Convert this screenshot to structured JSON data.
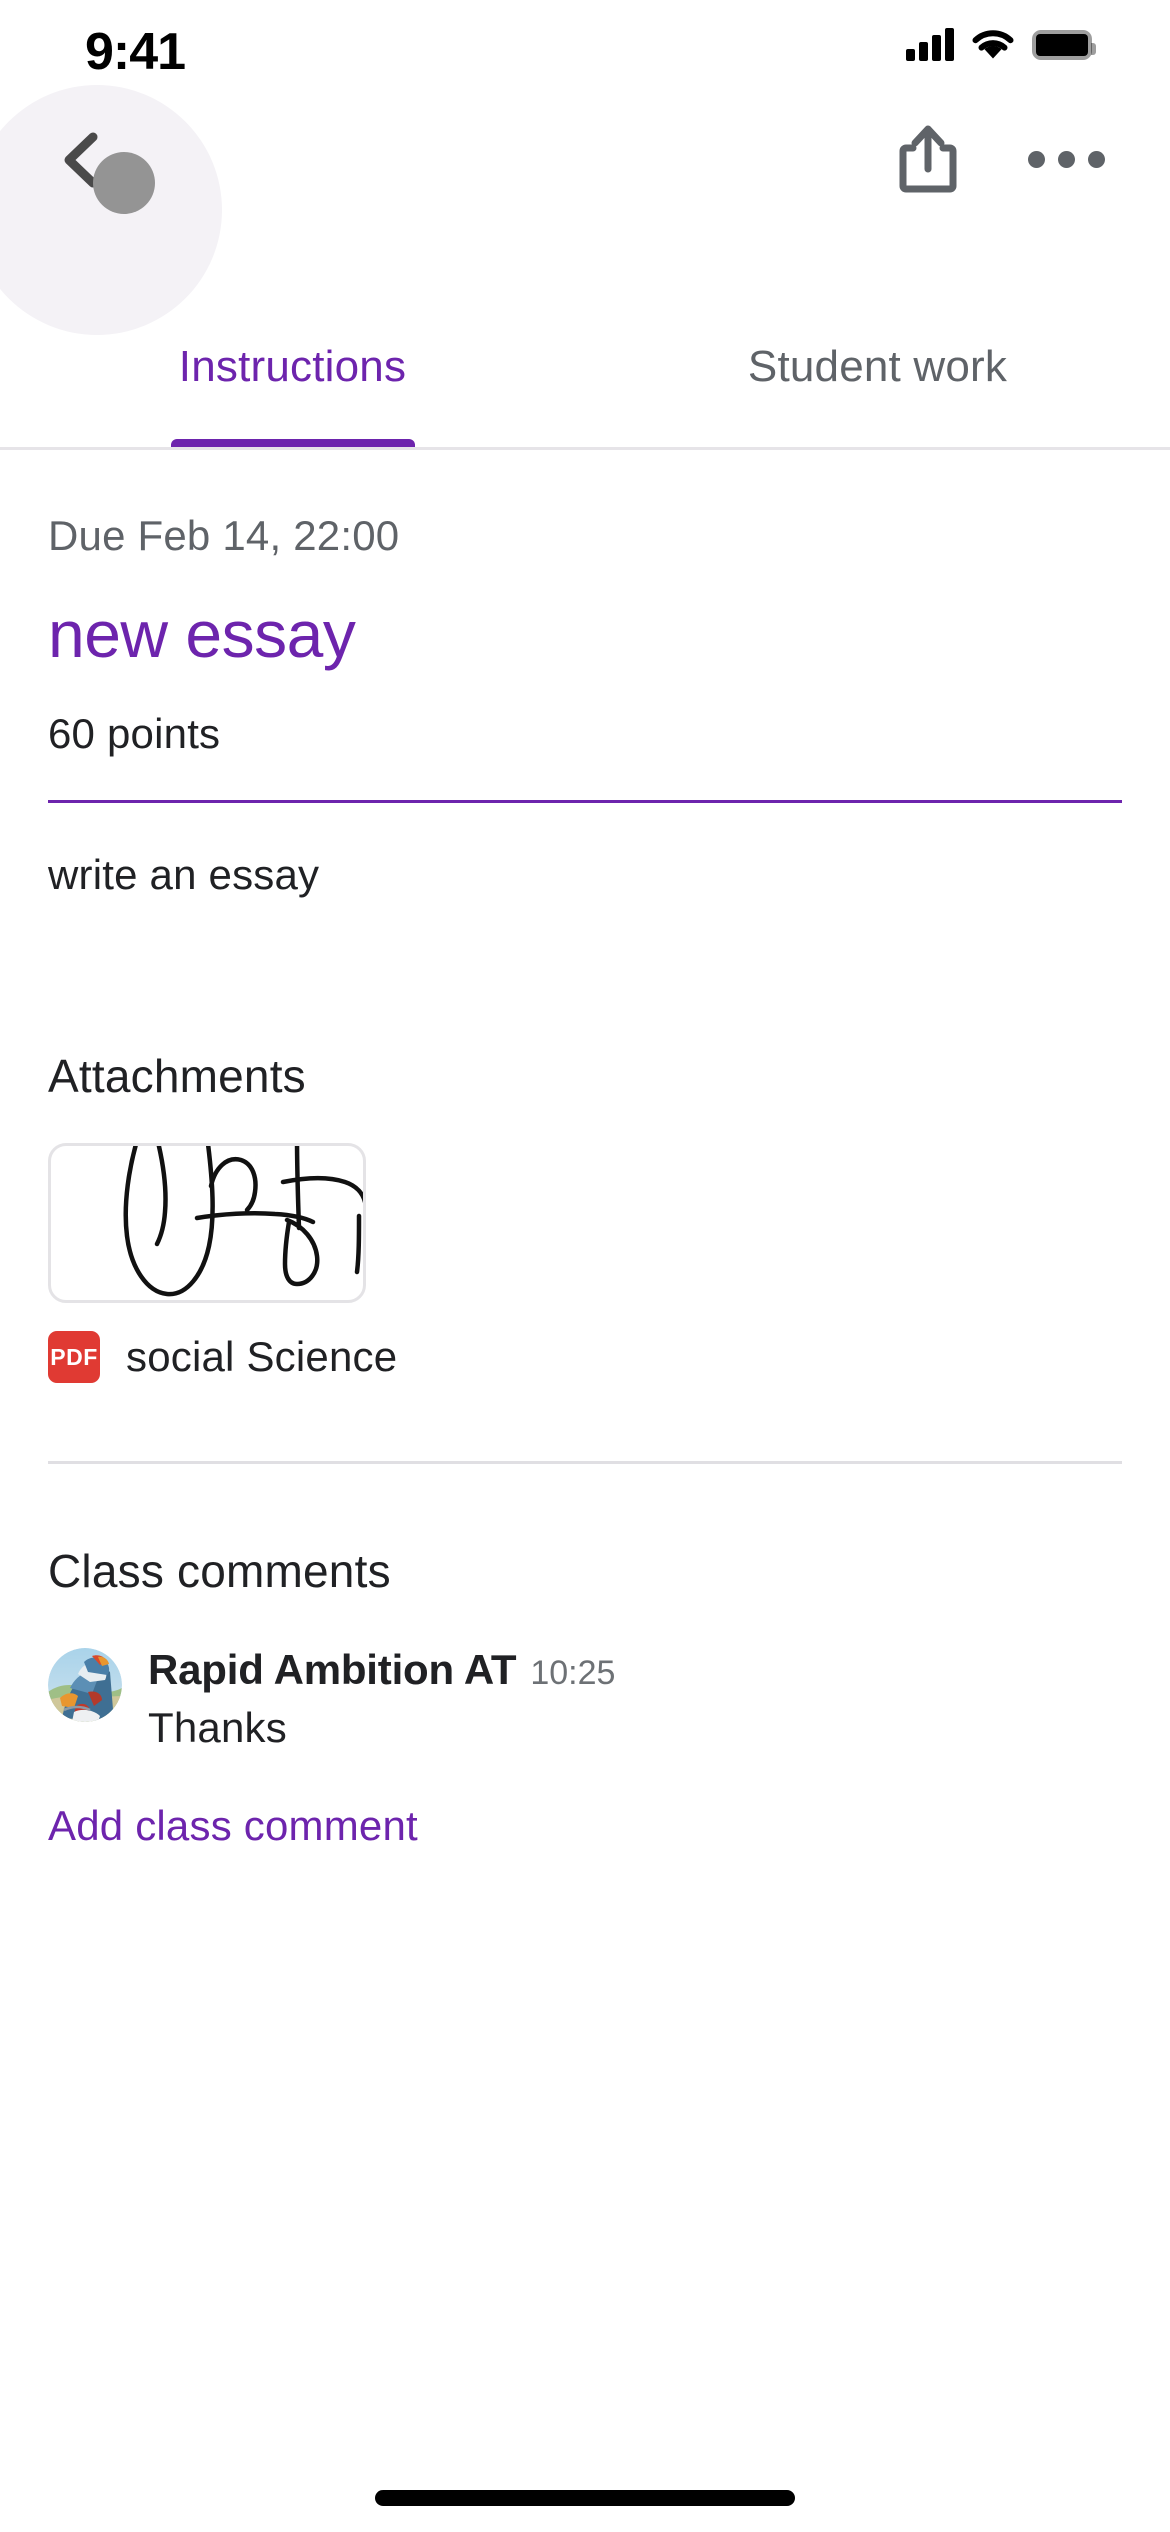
{
  "status_bar": {
    "time": "9:41",
    "cellular_icon": "signal-bars-icon",
    "wifi_icon": "wifi-icon",
    "battery_icon": "battery-full-icon"
  },
  "nav_bar": {
    "back_icon": "back-chevron-icon",
    "touch_indicator": "touch-pointer-dot",
    "share_icon": "share-icon",
    "more_icon": "more-horizontal-icon"
  },
  "tabs": [
    {
      "label": "Instructions",
      "active": true
    },
    {
      "label": "Student work",
      "active": false
    }
  ],
  "assignment": {
    "due": "Due Feb 14, 22:00",
    "title": "new essay",
    "points": "60 points",
    "description": "write an essay"
  },
  "attachments": {
    "heading": "Attachments",
    "items": [
      {
        "preview": "handwritten-scribble-thumbnail",
        "file_type_badge": "PDF",
        "name": "social Science"
      }
    ]
  },
  "comments": {
    "heading": "Class comments",
    "items": [
      {
        "avatar": "motocross-rider-avatar",
        "author": "Rapid Ambition AT",
        "time": "10:25",
        "text": "Thanks"
      }
    ],
    "add_label": "Add class comment"
  },
  "colors": {
    "accent_purple": "#6d24ad",
    "text_primary": "#202124",
    "text_secondary": "#5f6368",
    "pdf_red": "#e03a33",
    "divider": "#e0dfe3"
  },
  "home_indicator": "home-indicator"
}
